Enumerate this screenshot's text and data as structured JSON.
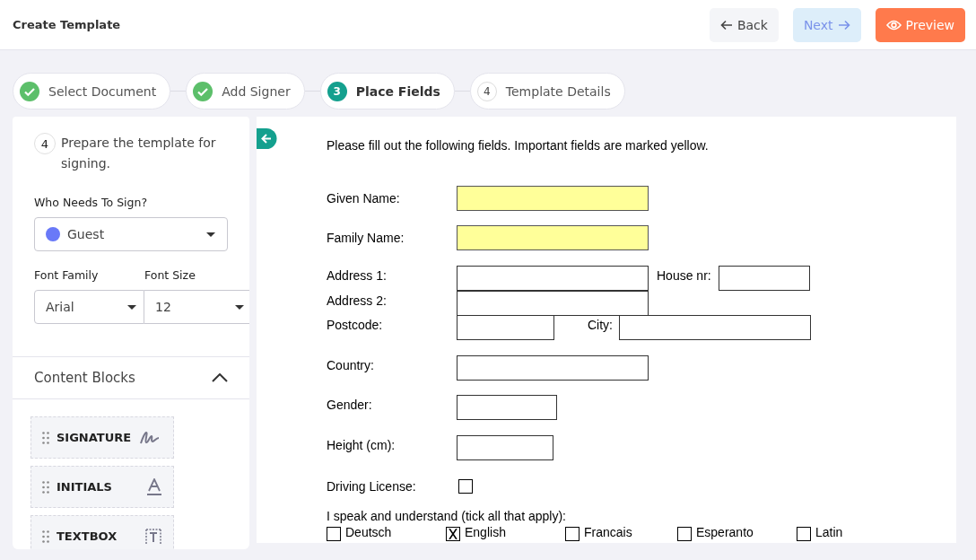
{
  "header": {
    "title": "Create Template",
    "buttons": [
      {
        "label": "Back",
        "kind": "back",
        "disabled": false
      },
      {
        "label": "Next",
        "kind": "next",
        "disabled": true
      },
      {
        "label": "Preview",
        "kind": "preview",
        "disabled": false
      }
    ]
  },
  "steps": [
    {
      "label": "Select Document",
      "completed": true,
      "selected": false
    },
    {
      "label": "Add Signer",
      "completed": true,
      "selected": false
    },
    {
      "number": "3",
      "label": "Place Fields",
      "completed": false,
      "selected": true
    },
    {
      "number": "4",
      "label": "Template Details",
      "completed": false,
      "selected": false
    }
  ],
  "sidebar": {
    "step_number": "4",
    "heading": "Prepare the template for signing.",
    "signer_label": "Who Needs To Sign?",
    "signer": {
      "name": "Guest",
      "color": "#6979f8"
    },
    "font_family_label": "Font Family",
    "font_family": "Arial",
    "font_size_label": "Font Size",
    "font_size": "12",
    "content_blocks": {
      "title": "Content Blocks",
      "expanded": true,
      "items": [
        {
          "label": "SIGNATURE",
          "kind": "signature"
        },
        {
          "label": "INITIALS",
          "kind": "initials"
        },
        {
          "label": "TEXTBOX",
          "kind": "textbox"
        }
      ]
    }
  },
  "document": {
    "paragraphs": [
      "Please fill out the following fields. Important fields are marked yellow."
    ],
    "rows": [
      {
        "items": [
          {
            "kind": "label",
            "text": "Given Name:"
          },
          {
            "kind": "field",
            "important": true
          }
        ]
      },
      {
        "items": [
          {
            "kind": "label",
            "text": "Family Name:"
          },
          {
            "kind": "field",
            "important": true
          }
        ]
      },
      {
        "items": [
          {
            "kind": "label",
            "text": "Address 1:"
          },
          {
            "kind": "field",
            "important": false
          },
          {
            "kind": "label",
            "text": "House nr:"
          },
          {
            "kind": "field",
            "important": false
          }
        ]
      },
      {
        "items": [
          {
            "kind": "label",
            "text": "Address 2:"
          },
          {
            "kind": "field",
            "important": false
          }
        ]
      },
      {
        "items": [
          {
            "kind": "label",
            "text": "Postcode:"
          },
          {
            "kind": "field",
            "important": false
          },
          {
            "kind": "label",
            "text": "City:"
          },
          {
            "kind": "field",
            "important": false
          }
        ]
      },
      {
        "items": [
          {
            "kind": "label",
            "text": "Country:"
          },
          {
            "kind": "field",
            "important": false
          }
        ]
      },
      {
        "items": [
          {
            "kind": "label",
            "text": "Gender:"
          },
          {
            "kind": "field",
            "important": false
          }
        ]
      },
      {
        "items": [
          {
            "kind": "label",
            "text": "Height (cm):"
          },
          {
            "kind": "field",
            "important": false
          }
        ]
      },
      {
        "items": [
          {
            "kind": "label",
            "text": "Driving License:"
          },
          {
            "kind": "checkbox",
            "checked": false
          }
        ]
      }
    ],
    "languages_prompt": "I speak and understand (tick all that apply):",
    "languages": [
      {
        "label": "Deutsch",
        "checked": false
      },
      {
        "label": "English",
        "checked": true
      },
      {
        "label": "Francais",
        "checked": false
      },
      {
        "label": "Esperanto",
        "checked": false
      },
      {
        "label": "Latin",
        "checked": false
      }
    ]
  }
}
